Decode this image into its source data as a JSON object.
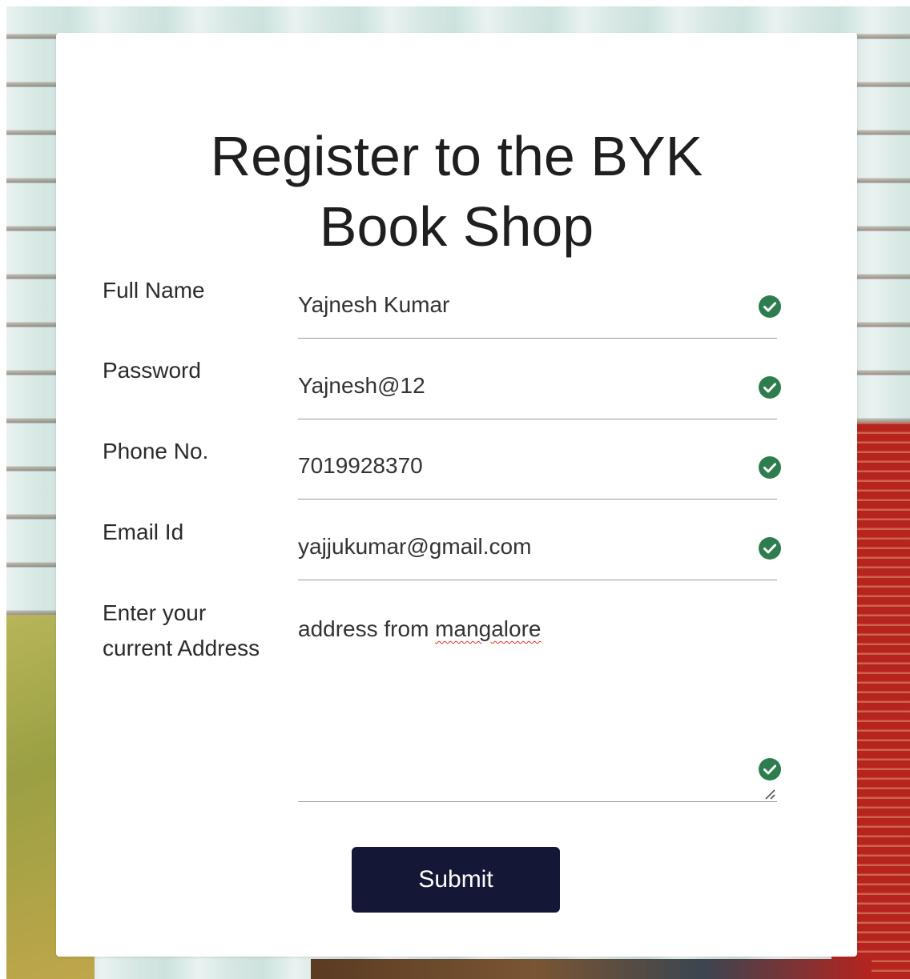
{
  "form": {
    "title_line1": "Register to the BYK",
    "title_line2": "Book Shop",
    "fields": [
      {
        "label": "Full Name",
        "value": "Yajnesh Kumar",
        "status": "valid"
      },
      {
        "label": "Password",
        "value": "Yajnesh@12",
        "status": "valid"
      },
      {
        "label": "Phone No.",
        "value": "7019928370",
        "status": "valid"
      },
      {
        "label": "Email Id",
        "value": "yajjukumar@gmail.com",
        "status": "valid"
      }
    ],
    "address": {
      "label_line1": "Enter your",
      "label_line2": "current Address",
      "value_prefix": "address from ",
      "value_misspelled": "mangalore",
      "status": "valid"
    },
    "submit_label": "Submit"
  },
  "colors": {
    "valid_check": "#2e7d4f",
    "submit_bg": "#141836",
    "spellcheck_underline": "#d93025"
  },
  "icons": {
    "valid": "check-circle-icon",
    "resize": "resize-handle-icon"
  }
}
